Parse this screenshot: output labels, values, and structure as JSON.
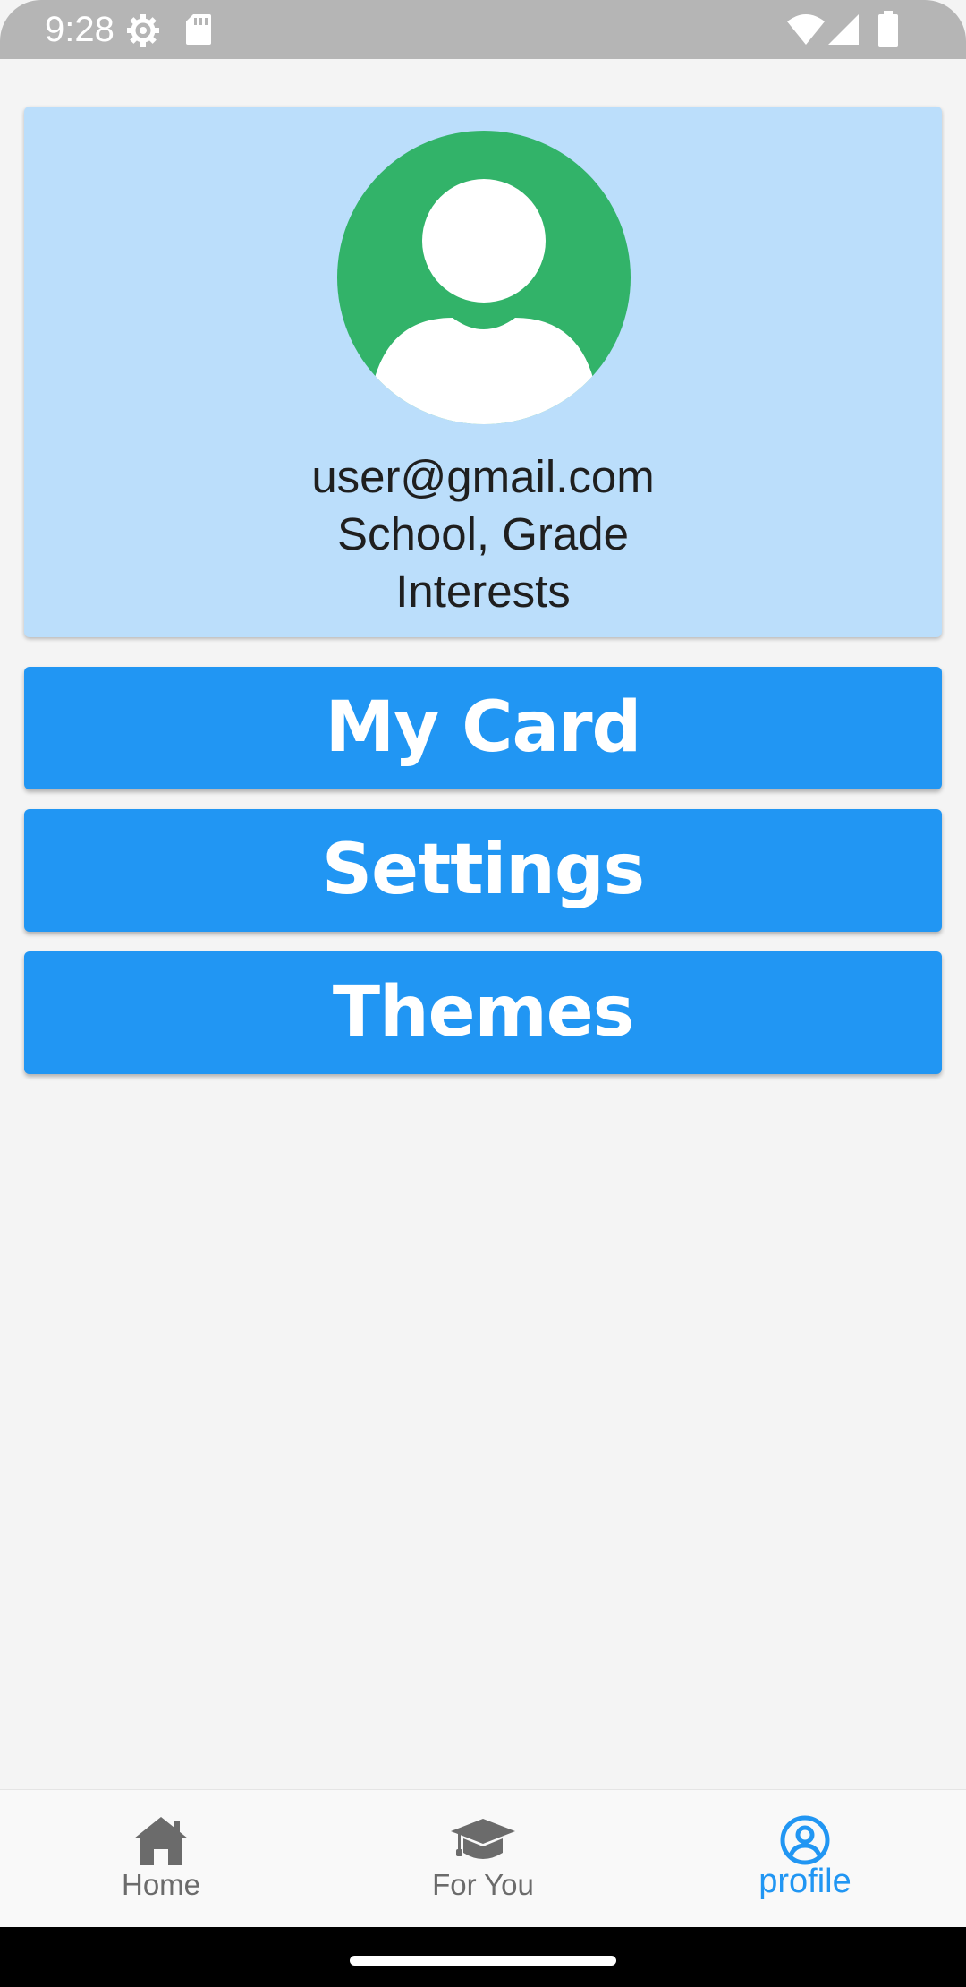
{
  "status_bar": {
    "time": "9:28",
    "icons": [
      "settings-gear-icon",
      "sd-card-icon",
      "wifi-icon",
      "signal-icon",
      "battery-icon"
    ]
  },
  "profile": {
    "email": "user@gmail.com",
    "school_grade": "School, Grade",
    "interests": "Interests",
    "avatar_color": "#32b369",
    "card_color": "#bbdefb"
  },
  "menu": {
    "my_card": "My Card",
    "settings": "Settings",
    "themes": "Themes",
    "button_color": "#2196f3"
  },
  "bottom_nav": {
    "items": [
      {
        "label": "Home",
        "icon": "home-icon",
        "active": false
      },
      {
        "label": "For You",
        "icon": "graduation-cap-icon",
        "active": false
      },
      {
        "label": "profile",
        "icon": "account-circle-icon",
        "active": true
      }
    ],
    "active_color": "#2196f3",
    "inactive_color": "#6b6b6b"
  }
}
